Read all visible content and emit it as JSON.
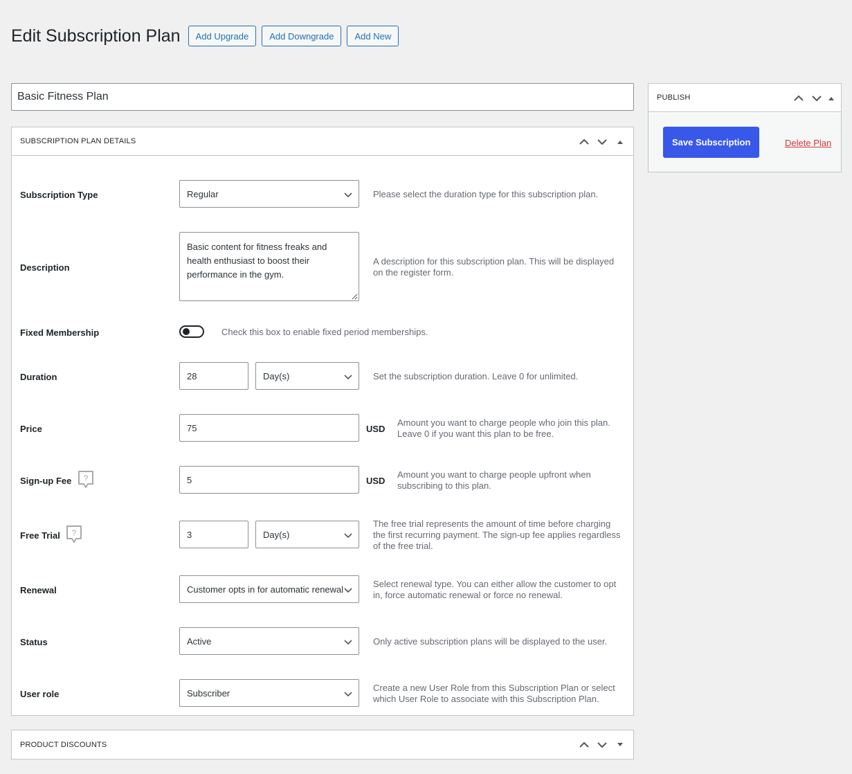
{
  "header": {
    "title": "Edit Subscription Plan",
    "buttons": [
      "Add Upgrade",
      "Add Downgrade",
      "Add New"
    ]
  },
  "plan_title": "Basic Fitness Plan",
  "details_box": {
    "title": "SUBSCRIPTION PLAN DETAILS",
    "fields": {
      "subscription_type": {
        "label": "Subscription Type",
        "value": "Regular",
        "help": "Please select the duration type for this subscription plan."
      },
      "description": {
        "label": "Description",
        "value": "Basic content for fitness freaks and health enthusiast to boost their performance in the gym.",
        "help": "A description for this subscription plan. This will be displayed on the register form."
      },
      "fixed_membership": {
        "label": "Fixed Membership",
        "enabled": false,
        "help": "Check this box to enable fixed period memberships."
      },
      "duration": {
        "label": "Duration",
        "value": "28",
        "unit": "Day(s)",
        "help": "Set the subscription duration. Leave 0 for unlimited."
      },
      "price": {
        "label": "Price",
        "value": "75",
        "currency": "USD",
        "help": "Amount you want to charge people who join this plan. Leave 0 if you want this plan to be free."
      },
      "signup_fee": {
        "label": "Sign-up Fee",
        "value": "5",
        "currency": "USD",
        "help": "Amount you want to charge people upfront when subscribing to this plan."
      },
      "free_trial": {
        "label": "Free Trial",
        "value": "3",
        "unit": "Day(s)",
        "help": "The free trial represents the amount of time before charging the first recurring payment. The sign-up fee applies regardless of the free trial."
      },
      "renewal": {
        "label": "Renewal",
        "value": "Customer opts in for automatic renewal",
        "help": "Select renewal type. You can either allow the customer to opt in, force automatic renewal or force no renewal."
      },
      "status": {
        "label": "Status",
        "value": "Active",
        "help": "Only active subscription plans will be displayed to the user."
      },
      "user_role": {
        "label": "User role",
        "value": "Subscriber",
        "help": "Create a new User Role from this Subscription Plan or select which User Role to associate with this Subscription Plan."
      }
    }
  },
  "discounts_box": {
    "title": "PRODUCT DISCOUNTS"
  },
  "publish_box": {
    "title": "PUBLISH",
    "save_label": "Save Subscription",
    "delete_label": "Delete Plan"
  },
  "colors": {
    "primary": "#3858e9",
    "link": "#2271b1",
    "danger": "#d63638",
    "background": "#f0f0f1"
  },
  "icons": [
    "chevron-up-icon",
    "chevron-down-icon",
    "collapse-arrow-icon",
    "select-chevron-icon",
    "help-bubble-icon",
    "resize-grip-icon"
  ]
}
